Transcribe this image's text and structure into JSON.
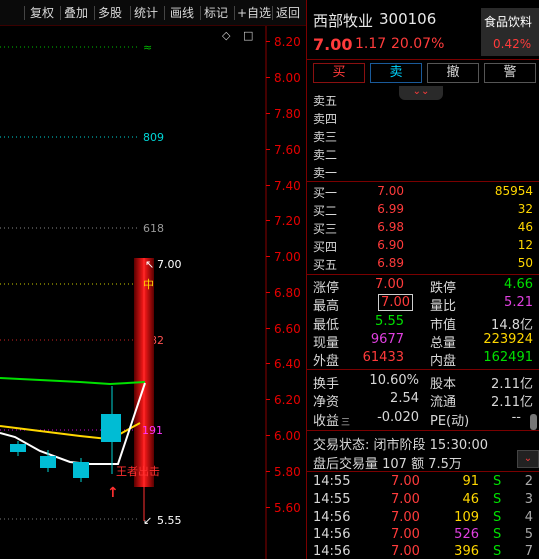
{
  "toolbar": {
    "items": [
      "复权",
      "叠加",
      "多股",
      "统计",
      "画线",
      "标记",
      "+自选",
      "返回"
    ]
  },
  "chart": {
    "y_axis_ticks": [
      "8.20",
      "8.00",
      "7.80",
      "7.60",
      "7.40",
      "7.20",
      "7.00",
      "6.80",
      "6.60",
      "6.40",
      "6.20",
      "6.00",
      "5.80",
      "5.60"
    ],
    "level_labels": {
      "green_top": "≈",
      "cyan_809": "809",
      "gray_618": "618",
      "red_382": "382",
      "zhong": "中",
      "magenta_191": "191"
    },
    "high_label": "7.00",
    "low_label": "5.55",
    "signal_text": "王者出击",
    "menu_glyphs": {
      "diamond": "◇",
      "square": "□"
    },
    "colors": {
      "up": "#ff3030",
      "down": "#00e5ff",
      "yellow": "#ffd700",
      "green": "#00d000"
    }
  },
  "stock": {
    "name": "西部牧业",
    "code": "300106",
    "price": "7.00",
    "change": "1.17",
    "change_pct": "20.07%",
    "sector": "食品饮料",
    "sector_pct": "0.42%"
  },
  "actions": {
    "buy": "买",
    "sell": "卖",
    "cancel": "撤",
    "alert": "警"
  },
  "orderbook": {
    "sell": [
      {
        "label": "卖五",
        "price": "",
        "vol": ""
      },
      {
        "label": "卖四",
        "price": "",
        "vol": ""
      },
      {
        "label": "卖三",
        "price": "",
        "vol": ""
      },
      {
        "label": "卖二",
        "price": "",
        "vol": ""
      },
      {
        "label": "卖一",
        "price": "",
        "vol": ""
      }
    ],
    "buy": [
      {
        "label": "买一",
        "price": "7.00",
        "vol": "85954"
      },
      {
        "label": "买二",
        "price": "6.99",
        "vol": "32"
      },
      {
        "label": "买三",
        "price": "6.98",
        "vol": "46"
      },
      {
        "label": "买四",
        "price": "6.90",
        "vol": "12"
      },
      {
        "label": "买五",
        "price": "6.89",
        "vol": "50"
      }
    ]
  },
  "quote": {
    "limit_up_label": "涨停",
    "limit_up": "7.00",
    "limit_down_label": "跌停",
    "limit_down": "4.66",
    "high_label": "最高",
    "high": "7.00",
    "vol_ratio_label": "量比",
    "vol_ratio": "5.21",
    "low_label": "最低",
    "low": "5.55",
    "mktcap_label": "市值",
    "mktcap": "14.8亿",
    "cur_vol_label": "现量",
    "cur_vol": "9677",
    "total_vol_label": "总量",
    "total_vol": "223924",
    "outer_label": "外盘",
    "outer": "61433",
    "inner_label": "内盘",
    "inner": "162491",
    "turnover_label": "换手",
    "turnover": "10.60%",
    "shares_label": "股本",
    "shares": "2.11亿",
    "nav_label": "净资",
    "nav": "2.54",
    "float_label": "流通",
    "float": "2.11亿",
    "eps_label": "收益",
    "eps_sub": "三",
    "eps": "-0.020",
    "pe_label": "PE(动)",
    "pe": "--"
  },
  "status": {
    "trade_state": "交易状态: 闭市阶段 15:30:00",
    "after_hours": "盘后交易量 107 额 7.5万"
  },
  "ticks": [
    {
      "time": "14:55",
      "price": "7.00",
      "vol": "91",
      "side": "S",
      "n": "2"
    },
    {
      "time": "14:55",
      "price": "7.00",
      "vol": "46",
      "side": "S",
      "n": "3"
    },
    {
      "time": "14:56",
      "price": "7.00",
      "vol": "109",
      "side": "S",
      "n": "4"
    },
    {
      "time": "14:56",
      "price": "7.00",
      "vol": "526",
      "side": "S",
      "n": "5"
    },
    {
      "time": "14:56",
      "price": "7.00",
      "vol": "396",
      "side": "S",
      "n": "7"
    }
  ]
}
